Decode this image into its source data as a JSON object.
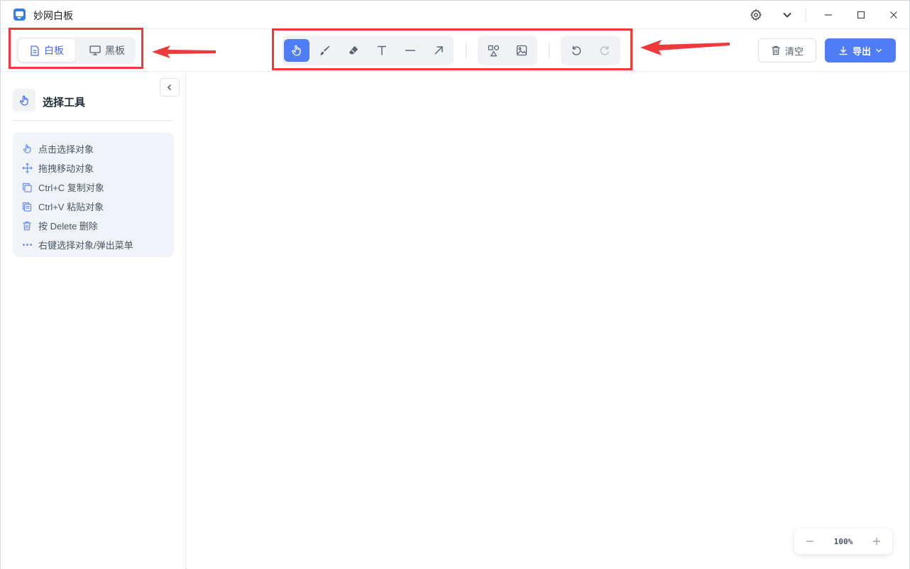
{
  "app": {
    "title": "妙网白板"
  },
  "modes": {
    "whiteboard": "白板",
    "blackboard": "黑板"
  },
  "toolbar": {
    "clear_label": "清空",
    "export_label": "导出",
    "tools": [
      {
        "id": "select",
        "icon": "hand-pointer-icon"
      },
      {
        "id": "brush",
        "icon": "brush-icon"
      },
      {
        "id": "eraser",
        "icon": "eraser-icon"
      },
      {
        "id": "text",
        "icon": "text-icon"
      },
      {
        "id": "line",
        "icon": "line-icon"
      },
      {
        "id": "arrow",
        "icon": "arrow-icon"
      }
    ]
  },
  "sidebar": {
    "tool_title": "选择工具",
    "tips": [
      {
        "icon": "hand-pointer-icon",
        "text": "点击选择对象"
      },
      {
        "icon": "move-icon",
        "text": "拖拽移动对象"
      },
      {
        "icon": "copy-icon",
        "text": "Ctrl+C 复制对象"
      },
      {
        "icon": "paste-icon",
        "text": "Ctrl+V 粘贴对象"
      },
      {
        "icon": "trash-icon",
        "text": "按 Delete 删除"
      },
      {
        "icon": "more-icon",
        "text": "右键选择对象/弹出菜单"
      }
    ]
  },
  "zoom": {
    "value": "100%"
  },
  "colors": {
    "accent": "#4f7cf7",
    "annotation": "#ee3a3a"
  }
}
